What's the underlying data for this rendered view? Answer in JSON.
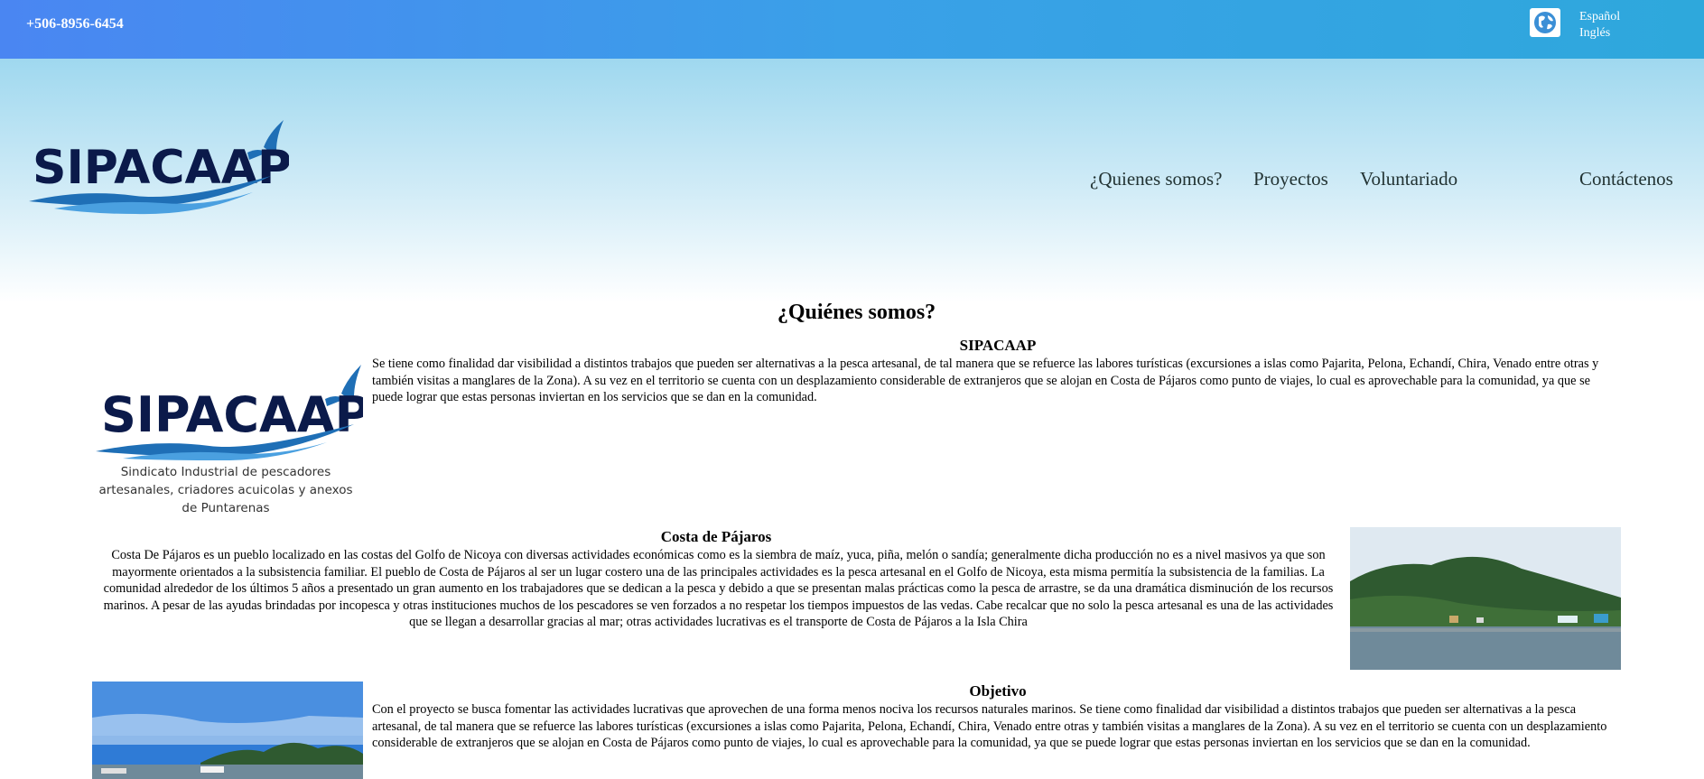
{
  "topbar": {
    "phone": "+506-8956-6454",
    "globe_icon": "globe-icon",
    "languages": [
      "Español",
      "Inglés"
    ]
  },
  "brand": {
    "logo_text": "SIPACAAP"
  },
  "nav": {
    "items": [
      "¿Quienes somos?",
      "Proyectos",
      "Voluntariado",
      "Contáctenos"
    ]
  },
  "main": {
    "heading": "¿Quiénes somos?",
    "sections": [
      {
        "title": "SIPACAAP",
        "text": "Se tiene como finalidad dar visibilidad a distintos trabajos que pueden ser alternativas a la pesca artesanal, de tal manera que se refuerce las labores turísticas (excursiones a islas como Pajarita, Pelona, Echandí, Chira, Venado entre otras y también visitas a manglares de la Zona). A su vez en el territorio se cuenta con un desplazamiento considerable de extranjeros que se alojan en Costa de Pájaros como punto de viajes, lo cual es aprovechable para la comunidad, ya que se puede lograr que estas personas inviertan en los servicios que se dan en la comunidad.",
        "logo_text": "SIPACAAP",
        "logo_caption": "Sindicato Industrial de pescadores artesanales, criadores acuicolas y anexos  de Puntarenas"
      },
      {
        "title": "Costa de Pájaros",
        "text": "Costa De Pájaros es un pueblo localizado en las costas del Golfo de Nicoya con diversas actividades económicas como es la siembra de maíz, yuca, piña, melón o sandía; generalmente dicha producción no es a nivel masivos ya que son mayormente orientados a la subsistencia familiar. El pueblo de Costa de Pájaros al ser un lugar costero una de las principales actividades es la pesca artesanal en el Golfo de Nicoya, esta misma permitía la subsistencia de la familias. La comunidad alrededor de los últimos 5 años a presentado un gran aumento en los trabajadores que se dedican a la pesca y debido a que se presentan malas prácticas como la pesca de arrastre, se da una dramática disminución de los recursos marinos. A pesar de las ayudas brindadas por incopesca y otras instituciones muchos de los pescadores se ven forzados a no respetar los tiempos impuestos de las vedas. Cabe recalcar que no solo la pesca artesanal es una de las actividades que se llegan a desarrollar gracias al mar; otras actividades lucrativas es el transporte de Costa de Pájaros a la Isla Chira"
      },
      {
        "title": "Objetivo",
        "text": "Con el proyecto se busca fomentar las actividades lucrativas que aprovechen de una forma menos nociva los recursos naturales marinos. Se tiene como finalidad dar visibilidad a distintos trabajos que pueden ser alternativas a la pesca artesanal, de tal manera que se refuerce las labores turísticas (excursiones a islas como Pajarita, Pelona, Echandí, Chira, Venado entre otras y también visitas a manglares de la Zona). A su vez en el territorio se cuenta con un desplazamiento considerable de extranjeros que se alojan en Costa de Pájaros como punto de viajes, lo cual es aprovechable para la comunidad, ya que se puede lograr que estas personas inviertan en los servicios que se dan en la comunidad."
      }
    ]
  },
  "colors": {
    "topbar_start": "#4a86f2",
    "topbar_end": "#2ea8dc",
    "logo_navy": "#0b1a4a",
    "logo_wave": "#1f6fb6"
  }
}
